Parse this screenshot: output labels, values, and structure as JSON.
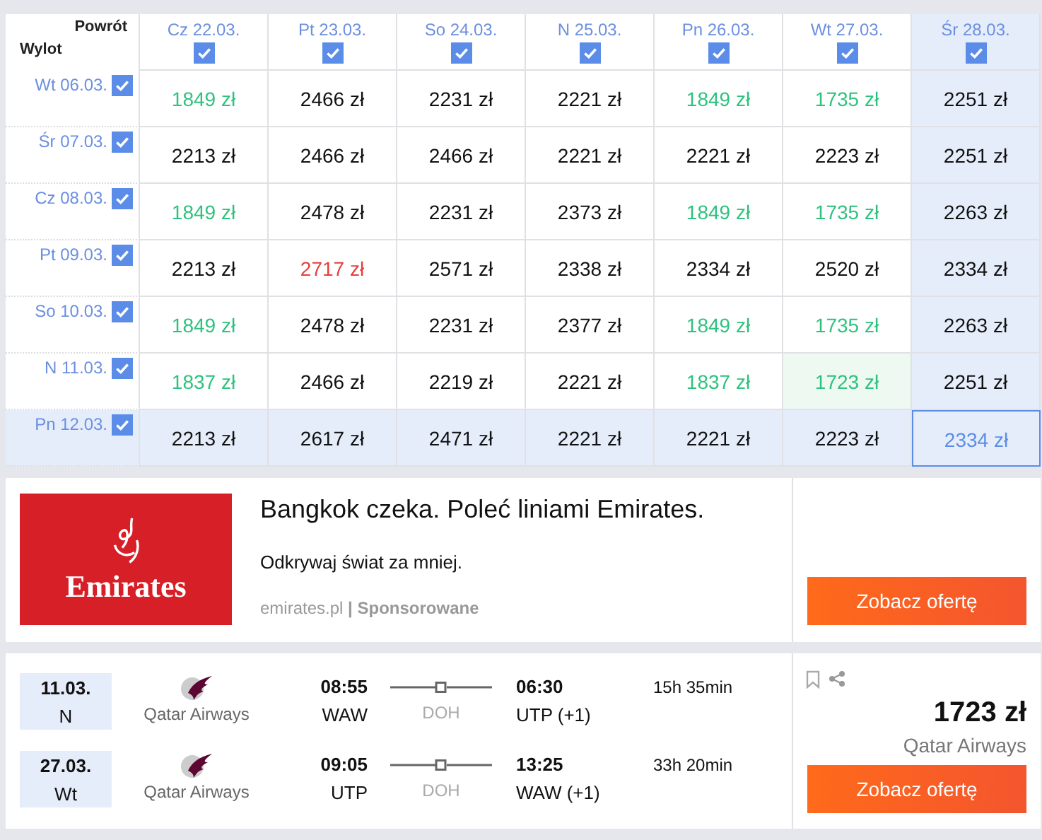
{
  "grid": {
    "return_label": "Powrót",
    "depart_label": "Wylot",
    "columns": [
      {
        "label": "Cz 22.03.",
        "checked": true,
        "selected": false
      },
      {
        "label": "Pt 23.03.",
        "checked": true,
        "selected": false
      },
      {
        "label": "So 24.03.",
        "checked": true,
        "selected": false
      },
      {
        "label": "N 25.03.",
        "checked": true,
        "selected": false
      },
      {
        "label": "Pn 26.03.",
        "checked": true,
        "selected": false
      },
      {
        "label": "Wt 27.03.",
        "checked": true,
        "selected": false
      },
      {
        "label": "Śr 28.03.",
        "checked": true,
        "selected": true
      }
    ],
    "rows": [
      {
        "label": "Wt 06.03.",
        "checked": true,
        "selected": false,
        "cells": [
          {
            "price": "1849 zł",
            "kind": "cheap"
          },
          {
            "price": "2466 zł",
            "kind": "normal"
          },
          {
            "price": "2231 zł",
            "kind": "normal"
          },
          {
            "price": "2221 zł",
            "kind": "normal"
          },
          {
            "price": "1849 zł",
            "kind": "cheap"
          },
          {
            "price": "1735 zł",
            "kind": "cheap"
          },
          {
            "price": "2251 zł",
            "kind": "normal"
          }
        ]
      },
      {
        "label": "Śr 07.03.",
        "checked": true,
        "selected": false,
        "cells": [
          {
            "price": "2213 zł",
            "kind": "normal"
          },
          {
            "price": "2466 zł",
            "kind": "normal"
          },
          {
            "price": "2466 zł",
            "kind": "normal"
          },
          {
            "price": "2221 zł",
            "kind": "normal"
          },
          {
            "price": "2221 zł",
            "kind": "normal"
          },
          {
            "price": "2223 zł",
            "kind": "normal"
          },
          {
            "price": "2251 zł",
            "kind": "normal"
          }
        ]
      },
      {
        "label": "Cz 08.03.",
        "checked": true,
        "selected": false,
        "cells": [
          {
            "price": "1849 zł",
            "kind": "cheap"
          },
          {
            "price": "2478 zł",
            "kind": "normal"
          },
          {
            "price": "2231 zł",
            "kind": "normal"
          },
          {
            "price": "2373 zł",
            "kind": "normal"
          },
          {
            "price": "1849 zł",
            "kind": "cheap"
          },
          {
            "price": "1735 zł",
            "kind": "cheap"
          },
          {
            "price": "2263 zł",
            "kind": "normal"
          }
        ]
      },
      {
        "label": "Pt 09.03.",
        "checked": true,
        "selected": false,
        "cells": [
          {
            "price": "2213 zł",
            "kind": "normal"
          },
          {
            "price": "2717 zł",
            "kind": "expensive"
          },
          {
            "price": "2571 zł",
            "kind": "normal"
          },
          {
            "price": "2338 zł",
            "kind": "normal"
          },
          {
            "price": "2334 zł",
            "kind": "normal"
          },
          {
            "price": "2520 zł",
            "kind": "normal"
          },
          {
            "price": "2334 zł",
            "kind": "normal"
          }
        ]
      },
      {
        "label": "So 10.03.",
        "checked": true,
        "selected": false,
        "cells": [
          {
            "price": "1849 zł",
            "kind": "cheap"
          },
          {
            "price": "2478 zł",
            "kind": "normal"
          },
          {
            "price": "2231 zł",
            "kind": "normal"
          },
          {
            "price": "2377 zł",
            "kind": "normal"
          },
          {
            "price": "1849 zł",
            "kind": "cheap"
          },
          {
            "price": "1735 zł",
            "kind": "cheap"
          },
          {
            "price": "2263 zł",
            "kind": "normal"
          }
        ]
      },
      {
        "label": "N 11.03.",
        "checked": true,
        "selected": false,
        "cells": [
          {
            "price": "1837 zł",
            "kind": "cheap"
          },
          {
            "price": "2466 zł",
            "kind": "normal"
          },
          {
            "price": "2219 zł",
            "kind": "normal"
          },
          {
            "price": "2221 zł",
            "kind": "normal"
          },
          {
            "price": "1837 zł",
            "kind": "cheap"
          },
          {
            "price": "1723 zł",
            "kind": "best"
          },
          {
            "price": "2251 zł",
            "kind": "normal"
          }
        ]
      },
      {
        "label": "Pn 12.03.",
        "checked": true,
        "selected": true,
        "cells": [
          {
            "price": "2213 zł",
            "kind": "normal"
          },
          {
            "price": "2617 zł",
            "kind": "normal"
          },
          {
            "price": "2471 zł",
            "kind": "normal"
          },
          {
            "price": "2221 zł",
            "kind": "normal"
          },
          {
            "price": "2221 zł",
            "kind": "normal"
          },
          {
            "price": "2223 zł",
            "kind": "normal"
          },
          {
            "price": "2334 zł",
            "kind": "normal"
          }
        ]
      }
    ]
  },
  "ad": {
    "logo_text": "Emirates",
    "headline": "Bangkok czeka. Poleć liniami Emirates.",
    "description": "Odkrywaj świat za mniej.",
    "domain": "emirates.pl",
    "separator": "|",
    "sponsored": "Sponsorowane",
    "button": "Zobacz ofertę"
  },
  "flight": {
    "legs": [
      {
        "date": "11.03.",
        "day": "N",
        "airline": "Qatar Airways",
        "dep_time": "08:55",
        "dep_airport": "WAW",
        "stop": "DOH",
        "arr_time": "06:30",
        "arr_airport": "UTP (+1)",
        "duration": "15h 35min"
      },
      {
        "date": "27.03.",
        "day": "Wt",
        "airline": "Qatar Airways",
        "dep_time": "09:05",
        "dep_airport": "UTP",
        "stop": "DOH",
        "arr_time": "13:25",
        "arr_airport": "WAW (+1)",
        "duration": "33h 20min"
      }
    ],
    "price": "1723 zł",
    "price_airline": "Qatar Airways",
    "button": "Zobacz ofertę"
  }
}
